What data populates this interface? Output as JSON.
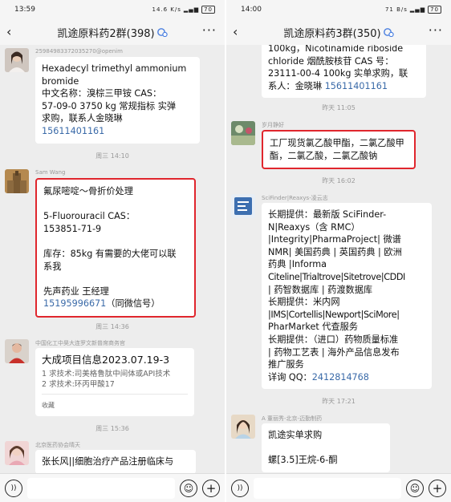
{
  "left": {
    "status": {
      "time": "13:59",
      "net": "14.6 K/s",
      "battery": "70"
    },
    "title": "凯途原料药2群(398)",
    "messages": {
      "m1": {
        "sender": "25984983372035270@openim",
        "lines": [
          "Hexadecyl trimethyl ammonium",
          "bromide",
          "中文名称：溴棕三甲铵  CAS：",
          "57-09-0  3750 kg 常规指标 实弹",
          "求购，联系人金晓琳"
        ],
        "phone": "15611401161"
      },
      "ts1": "周三 14:10",
      "m2": {
        "sender": "Sam Wang",
        "lines": [
          "氟尿嘧啶～骨折价处理",
          "",
          "5-Fluorouracil     CAS：",
          "153851-71-9",
          "",
          "库存：85kg   有需要的大佬可以联",
          "系我",
          "",
          "先声药业   王经理"
        ],
        "phone": "15195996671",
        "phone_suffix": "（同微信号）"
      },
      "ts2": "周三 14:36",
      "m3": {
        "sender": "中国化工中昊大连罗文新普席商务官",
        "title": "大成项目信息2023.07.19-3",
        "lines": [
          "1 求技术:司美格鲁肽中间体或API技术",
          "2 求技术:环丙甲酸17"
        ],
        "footer": "收藏"
      },
      "ts3": "周三 15:36",
      "m4": {
        "sender": "北京医药协会晴天",
        "lines": [
          "张长风||细胞治疗产品注册临床与"
        ]
      }
    }
  },
  "right": {
    "status": {
      "time": "14:00",
      "net": "71 B/s",
      "battery": "70"
    },
    "title": "凯途原料药3群(350)",
    "messages": {
      "m0": {
        "lines": [
          "100kg，Nicotinamide riboside",
          "chloride 烟酰胺核苷 CAS 号：",
          "23111-00-4 100kg 实单求购，联",
          "系人：金晓琳 "
        ],
        "phone": "15611401161"
      },
      "ts1": "昨天 11:05",
      "m1": {
        "sender": "岁月静好",
        "lines": [
          "工厂现货氯乙酸甲酯，二氯乙酸甲",
          "酯，二氯乙酸，二氯乙酸钠"
        ]
      },
      "ts2": "昨天 16:02",
      "m2": {
        "sender": "SciFinder|Reaxys-凌云志",
        "lines": [
          "长期提供：最新版 SciFinder-",
          "N|Reaxys（含 RMC）",
          "|Integrity|PharmaProject| 微谱",
          "NMR| 美国药典 | 英国药典 | 欧洲",
          "药典 |Informa",
          "Citeline|Trialtrove|Sitetrove|CDDI",
          "| 药智数据库 | 药渡数据库",
          "长期提供：米内网",
          "|IMS|Cortellis|Newport|SciMore|",
          "PharMarket 代查服务",
          "长期提供：（进口）药物质量标准",
          "| 药物工艺表 | 海外产品信息发布",
          "推广服务"
        ],
        "qq_label": "详询 QQ：",
        "qq": "2412814768"
      },
      "ts3": "昨天 17:21",
      "m3": {
        "sender": "A 董丽秀-北京-迈勤制药",
        "lines": [
          "凯途实单求购",
          "",
          "螺[3.5]王烷-6-酮"
        ]
      }
    }
  },
  "colors": {
    "highlight": "#e0262d",
    "link": "#3a6aa8",
    "chat_bg": "#ededed"
  },
  "icons": [
    "back-icon",
    "more-icon",
    "group-icon",
    "voice-icon",
    "emoji-icon",
    "plus-icon"
  ]
}
